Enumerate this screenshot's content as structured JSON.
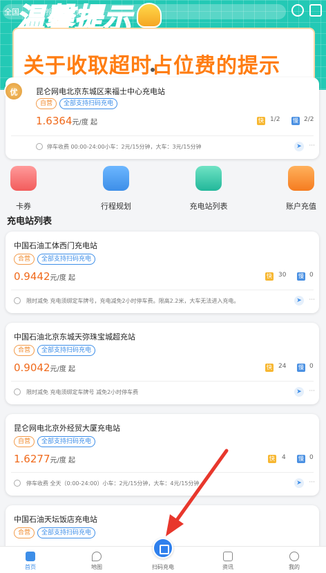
{
  "top": {
    "city": "全国",
    "search_placeholder": "搜索充电站",
    "banner_title": "温馨提示",
    "notice_text": "关于收取超时占位费的提示"
  },
  "featured": {
    "badge": "优",
    "name": "昆仑网电北京东城区来福士中心充电站",
    "tag_self": "自营",
    "tag_scan": "全部支持扫码充电",
    "price": "1.6364",
    "price_unit": "元/度 起",
    "fast_label": "快",
    "fast_count": "1/2",
    "slow_label": "慢",
    "slow_count": "2/2",
    "parking": "停车收费   00:00-24:00小车：2元/15分钟，大车：3元/15分钟",
    "more": "···"
  },
  "quick_menu": [
    {
      "label": "卡券",
      "icon": "coupon-icon"
    },
    {
      "label": "行程规划",
      "icon": "route-plan-icon"
    },
    {
      "label": "充电站列表",
      "icon": "station-list-icon"
    },
    {
      "label": "账户充值",
      "icon": "account-recharge-icon"
    }
  ],
  "section_title": "充电站列表",
  "stations": [
    {
      "name": "中国石油工体西门充电站",
      "tag_self": "合营",
      "tag_scan": "全部支持扫码充电",
      "price": "0.9442",
      "price_unit": "元/度 起",
      "fast_label": "快",
      "fast_count": "30",
      "slow_label": "慢",
      "slow_count": "0",
      "parking": "限时减免    充电须绑定车牌号，充电减免2小时停车费。限高2.2米，大车无法进入充电。",
      "more": "···"
    },
    {
      "name": "中国石油北京东城天弥珠宝城超充站",
      "tag_self": "合营",
      "tag_scan": "全部支持扫码充电",
      "price": "0.9042",
      "price_unit": "元/度 起",
      "fast_label": "快",
      "fast_count": "24",
      "slow_label": "慢",
      "slow_count": "0",
      "parking": "限时减免    充电须绑定车牌号 减免2小时停车费",
      "more": "···"
    },
    {
      "name": "昆仑网电北京外经贸大厦充电站",
      "tag_self": "自营",
      "tag_scan": "全部支持扫码充电",
      "price": "1.6277",
      "price_unit": "元/度 起",
      "fast_label": "快",
      "fast_count": "4",
      "slow_label": "慢",
      "slow_count": "0",
      "parking": "停车收费    全天（0:00-24:00）小车：2元/15分钟，大车：4元/15分钟",
      "more": "···"
    },
    {
      "name": "中国石油天坛饭店充电站",
      "tag_self": "合营",
      "tag_scan": "全部支持扫码充电"
    }
  ],
  "bottom_nav": [
    {
      "label": "首页",
      "icon": "home-icon"
    },
    {
      "label": "地图",
      "icon": "map-pin-icon"
    },
    {
      "label": "扫码充电",
      "icon": "scan-icon"
    },
    {
      "label": "资讯",
      "icon": "news-icon"
    },
    {
      "label": "我的",
      "icon": "profile-icon"
    }
  ],
  "colors": {
    "banner": "#23c9b5",
    "accent": "#3d8ee8",
    "price": "#f06a1c",
    "arrow": "#e8372c"
  }
}
